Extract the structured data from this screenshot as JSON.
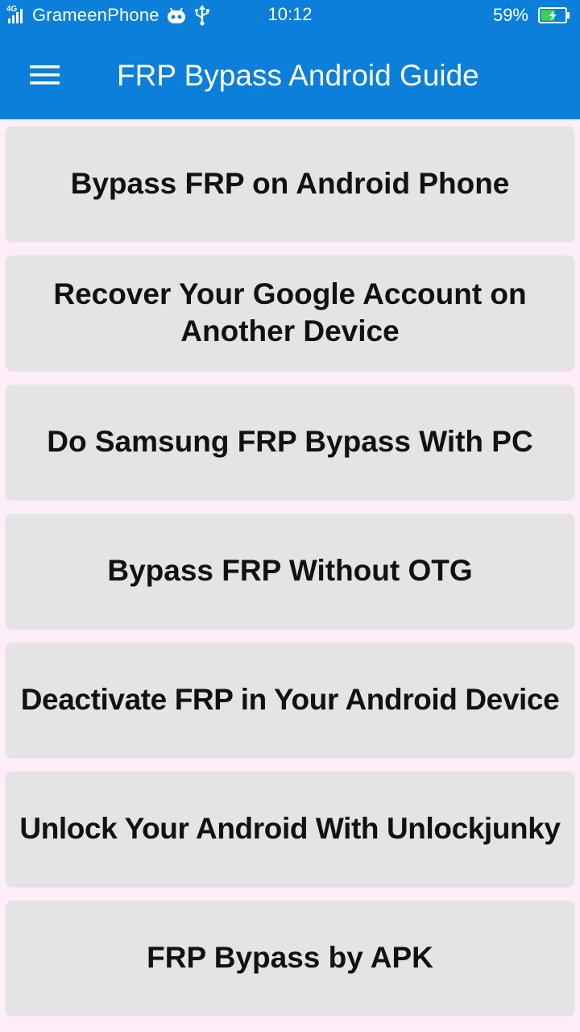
{
  "status_bar": {
    "network_type": "4G",
    "carrier": "GrameenPhone",
    "time": "10:12",
    "battery_percent": "59%",
    "battery_level": 0.59,
    "icons": [
      "signal-icon",
      "android-robot-icon",
      "usb-icon",
      "battery-charging-icon"
    ]
  },
  "app_bar": {
    "title": "FRP Bypass Android Guide",
    "menu_icon": "hamburger-menu-icon"
  },
  "menu_items": [
    {
      "label": "Bypass FRP on Android Phone"
    },
    {
      "label": "Recover Your Google Account on\nAnother Device"
    },
    {
      "label": "Do Samsung FRP Bypass With PC"
    },
    {
      "label": "Bypass FRP Without OTG"
    },
    {
      "label": "Deactivate FRP in Your Android Device"
    },
    {
      "label": "Unlock Your Android With Unlockjunky"
    },
    {
      "label": "FRP Bypass by APK"
    }
  ],
  "colors": {
    "app_bar": "#0b7fd9",
    "background": "#fdeefa",
    "card": "#e4e4e4",
    "card_text": "#111111",
    "battery_fill": "#39d353"
  }
}
